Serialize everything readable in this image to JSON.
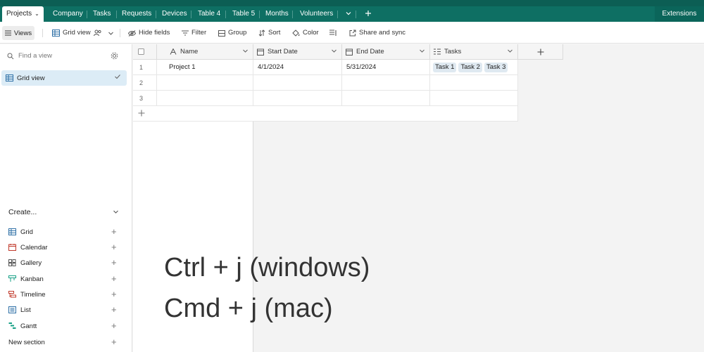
{
  "tabs": [
    {
      "label": "Projects",
      "active": true
    },
    {
      "label": "Company"
    },
    {
      "label": "Tasks"
    },
    {
      "label": "Requests"
    },
    {
      "label": "Devices"
    },
    {
      "label": "Table 4"
    },
    {
      "label": "Table 5"
    },
    {
      "label": "Months"
    },
    {
      "label": "Volunteers"
    }
  ],
  "extensions_label": "Extensions",
  "toolbar": {
    "views": "Views",
    "grid_view": "Grid view",
    "hide_fields": "Hide fields",
    "filter": "Filter",
    "group": "Group",
    "sort": "Sort",
    "color": "Color",
    "share": "Share and sync"
  },
  "sidebar": {
    "find_placeholder": "Find a view",
    "current_view": "Grid view",
    "create_label": "Create...",
    "create_items": [
      {
        "label": "Grid",
        "icon": "grid-icon"
      },
      {
        "label": "Calendar",
        "icon": "calendar-icon"
      },
      {
        "label": "Gallery",
        "icon": "gallery-icon"
      },
      {
        "label": "Kanban",
        "icon": "kanban-icon"
      },
      {
        "label": "Timeline",
        "icon": "timeline-icon"
      },
      {
        "label": "List",
        "icon": "list-icon"
      },
      {
        "label": "Gantt",
        "icon": "gantt-icon"
      },
      {
        "label": "New section",
        "icon": ""
      }
    ]
  },
  "table": {
    "columns": [
      "Name",
      "Start Date",
      "End Date",
      "Tasks"
    ],
    "rows": [
      {
        "num": "1",
        "name": "Project 1",
        "start": "4/1/2024",
        "end": "5/31/2024",
        "tasks": [
          "Task 1",
          "Task 2",
          "Task 3"
        ]
      },
      {
        "num": "2",
        "name": "",
        "start": "",
        "end": "",
        "tasks": []
      },
      {
        "num": "3",
        "name": "",
        "start": "",
        "end": "",
        "tasks": []
      }
    ]
  },
  "overlay": {
    "line1": "Ctrl + j (windows)",
    "line2": "Cmd + j (mac)"
  },
  "colors": {
    "header_teal": "#0e6f63",
    "selected_view": "#dcecf6",
    "chip": "#dfe9f1"
  }
}
